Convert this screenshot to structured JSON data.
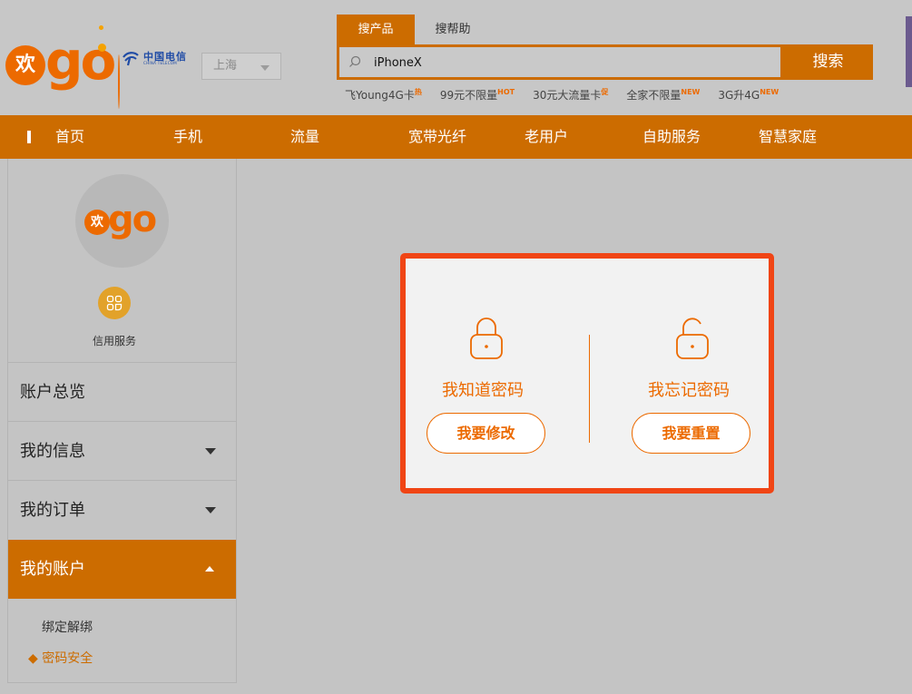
{
  "header": {
    "logo_huan": "欢",
    "logo_go": "go",
    "telecom_cn": "中国电信",
    "telecom_en": "CHINA TELECOM",
    "city": "上海",
    "search_tabs": [
      "搜产品",
      "搜帮助"
    ],
    "search_value": "iPhoneX",
    "search_button": "搜索",
    "hot_words": [
      {
        "text": "飞Young4G卡",
        "tag": "热"
      },
      {
        "text": "99元不限量",
        "tag": "HOT"
      },
      {
        "text": "30元大流量卡",
        "tag": "促"
      },
      {
        "text": "全家不限量",
        "tag": "NEW"
      },
      {
        "text": "3G升4G",
        "tag": "NEW"
      }
    ]
  },
  "nav": {
    "items": [
      "首页",
      "手机",
      "流量",
      "宽带光纤",
      "老用户",
      "自助服务",
      "智慧家庭"
    ]
  },
  "sidebar": {
    "avatar_huan": "欢",
    "avatar_go": "go",
    "credit_label": "信用服务",
    "menu": [
      "账户总览",
      "我的信息",
      "我的订单",
      "我的账户"
    ],
    "sub_items": [
      "绑定解绑",
      "◆ 密码安全"
    ]
  },
  "modal": {
    "left_title": "我知道密码",
    "left_button": "我要修改",
    "right_title": "我忘记密码",
    "right_button": "我要重置"
  },
  "colors": {
    "brand_orange": "#cc6c00",
    "accent_orange": "#ec6a00",
    "highlight_border": "#f04515",
    "telecom_blue": "#1f4ba5"
  }
}
